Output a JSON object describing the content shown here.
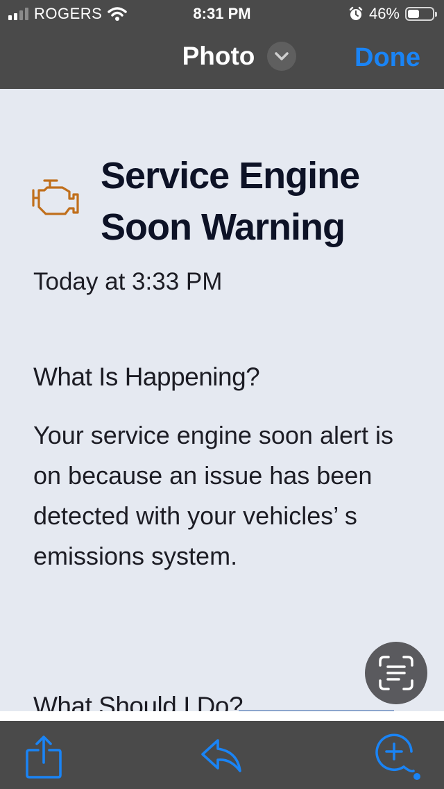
{
  "status_bar": {
    "carrier": "ROGERS",
    "time": "8:31 PM",
    "battery_percent": "46%",
    "battery_level": 0.46,
    "signal_bars": 2,
    "icons": [
      "signal-icon",
      "wifi-icon",
      "alarm-icon",
      "battery-icon"
    ]
  },
  "nav": {
    "title": "Photo",
    "done_label": "Done",
    "chevron_icon": "chevron-down-icon",
    "accent_color": "#1a84f5"
  },
  "document": {
    "alert_icon": "engine-warning-icon",
    "title": "Service Engine Soon Warning",
    "timestamp": "Today at 3:33 PM",
    "section1_heading": "What Is Happening?",
    "section1_body": "Your service engine soon alert is on because an issue has been detected with your vehicles’ s emissions system.",
    "section2_heading": "What Should I Do?",
    "warning_color": "#c06f1c"
  },
  "live_text": {
    "icon": "live-text-icon"
  },
  "toolbar": {
    "items": [
      "share-icon",
      "reply-icon",
      "markup-icon"
    ]
  }
}
